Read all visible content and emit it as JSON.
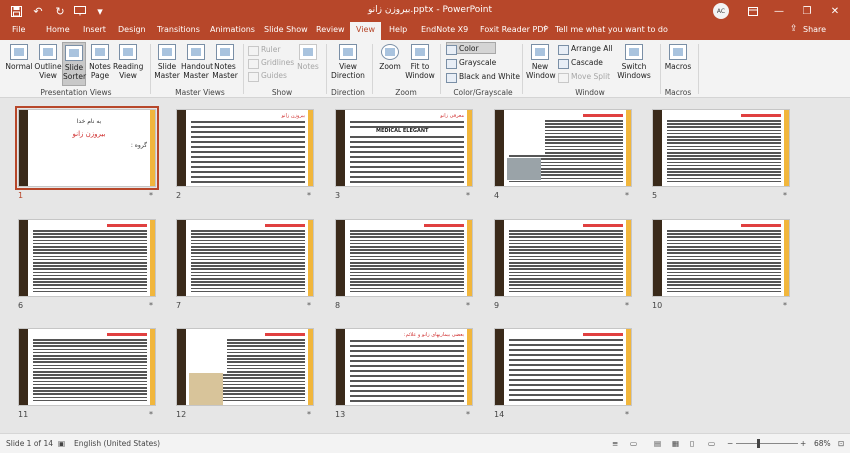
{
  "title_bar": {
    "title": "بیروزن زانو.pptx  -  PowerPoint",
    "avatar_initials": "AC"
  },
  "tabs": [
    {
      "label": "File"
    },
    {
      "label": "Home"
    },
    {
      "label": "Insert"
    },
    {
      "label": "Design"
    },
    {
      "label": "Transitions"
    },
    {
      "label": "Animations"
    },
    {
      "label": "Slide Show"
    },
    {
      "label": "Review"
    },
    {
      "label": "View",
      "active": true
    },
    {
      "label": "Help"
    },
    {
      "label": "EndNote X9"
    },
    {
      "label": "Foxit Reader PDF"
    }
  ],
  "tell_me": "Tell me what you want to do",
  "share": "Share",
  "ribbon": {
    "normal": "Normal",
    "outline_view": [
      "Outline",
      "View"
    ],
    "slide_sorter": [
      "Slide",
      "Sorter"
    ],
    "notes_page": [
      "Notes",
      "Page"
    ],
    "reading_view": [
      "Reading",
      "View"
    ],
    "group_presentation_views": "Presentation Views",
    "slide_master": [
      "Slide",
      "Master"
    ],
    "handout_master": [
      "Handout",
      "Master"
    ],
    "notes_master": [
      "Notes",
      "Master"
    ],
    "group_master_views": "Master Views",
    "ruler": "Ruler",
    "gridlines": "Gridlines",
    "guides": "Guides",
    "notes": "Notes",
    "group_show": "Show",
    "view_direction": [
      "View",
      "Direction"
    ],
    "group_direction": "Direction",
    "zoom": "Zoom",
    "fit_to_window": [
      "Fit to",
      "Window"
    ],
    "group_zoom": "Zoom",
    "color": "Color",
    "grayscale": "Grayscale",
    "black_and_white": "Black and White",
    "group_color": "Color/Grayscale",
    "new_window": [
      "New",
      "Window"
    ],
    "arrange_all": "Arrange All",
    "cascade": "Cascade",
    "move_split": "Move Split",
    "switch_windows": [
      "Switch",
      "Windows"
    ],
    "group_window": "Window",
    "macros": "Macros",
    "group_macros": "Macros"
  },
  "slides": [
    {
      "number": "1",
      "star": "*",
      "lines": [
        "به نام خدا",
        "بیروزن زانو",
        "گروه :"
      ]
    },
    {
      "number": "2",
      "star": "*",
      "lines": [
        "بیروزن زانو"
      ]
    },
    {
      "number": "3",
      "star": "*",
      "lines": [
        "معرفی زانو",
        "MEDICAL ELEGANT"
      ]
    },
    {
      "number": "4",
      "star": "*",
      "lines": []
    },
    {
      "number": "5",
      "star": "*",
      "lines": []
    },
    {
      "number": "6",
      "star": "*",
      "lines": []
    },
    {
      "number": "7",
      "star": "*",
      "lines": []
    },
    {
      "number": "8",
      "star": "*",
      "lines": []
    },
    {
      "number": "9",
      "star": "*",
      "lines": []
    },
    {
      "number": "10",
      "star": "*",
      "lines": []
    },
    {
      "number": "11",
      "star": "*",
      "lines": []
    },
    {
      "number": "12",
      "star": "*",
      "lines": []
    },
    {
      "number": "13",
      "star": "*",
      "lines": [
        "بعضی بیماریهای زانو و علائم:"
      ]
    },
    {
      "number": "14",
      "star": "*",
      "lines": []
    }
  ],
  "status": {
    "slide_info": "Slide 1 of 14",
    "language": "English (United States)",
    "zoom_percent": "68%",
    "zoom_level": 0.68,
    "minus": "−",
    "plus": "+"
  },
  "colors": {
    "accent": "#b7472a",
    "slide_bar_dark": "#3a2a1a",
    "slide_bar_gold": "#f1b63c"
  },
  "icons": [
    "save-icon",
    "undo-icon",
    "redo-icon",
    "present-icon",
    "customize-icon",
    "ribbon-display-icon",
    "minimize-icon",
    "restore-icon",
    "close-icon",
    "lightbulb-icon",
    "share-icon",
    "notes-icon",
    "comments-icon",
    "normal-view-icon",
    "sorter-view-icon",
    "reading-view-icon",
    "slideshow-icon"
  ]
}
